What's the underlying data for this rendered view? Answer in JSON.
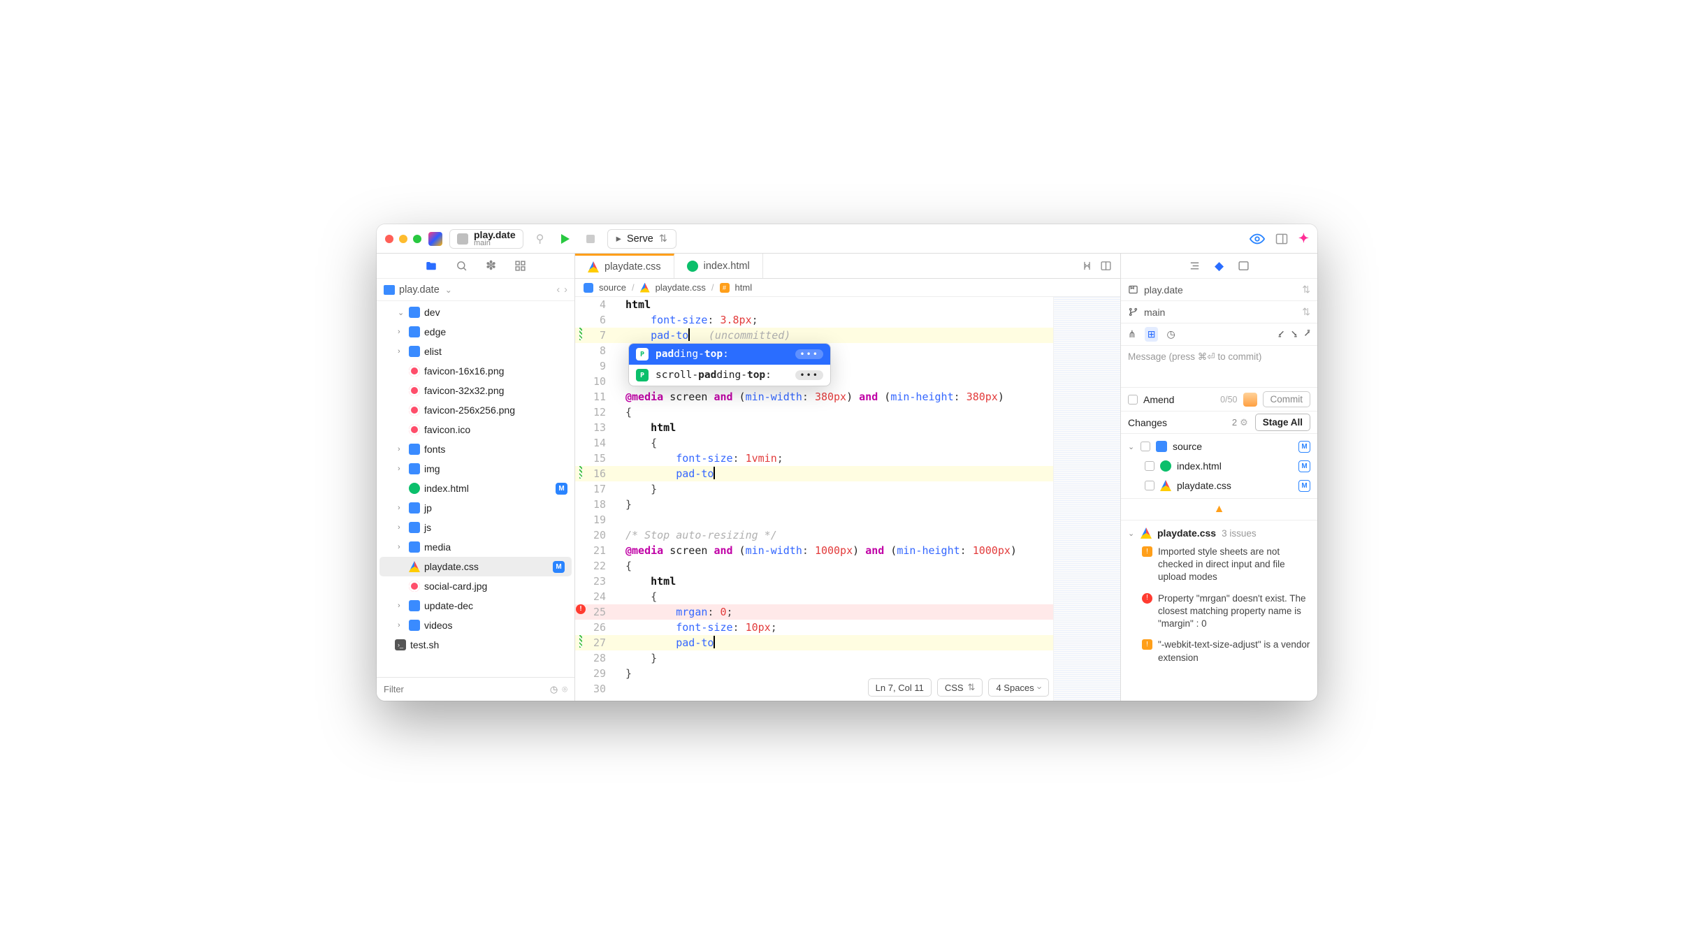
{
  "titlebar": {
    "project_name": "play.date",
    "branch": "main",
    "serve_label": "Serve"
  },
  "sidebar": {
    "crumb": "play.date",
    "filter_placeholder": "Filter",
    "items": [
      {
        "type": "folder",
        "name": "dev",
        "expanded": true,
        "depth": 1
      },
      {
        "type": "folder",
        "name": "edge",
        "depth": 1
      },
      {
        "type": "folder",
        "name": "elist",
        "depth": 1
      },
      {
        "type": "img",
        "name": "favicon-16x16.png",
        "depth": 1
      },
      {
        "type": "img",
        "name": "favicon-32x32.png",
        "depth": 1
      },
      {
        "type": "img",
        "name": "favicon-256x256.png",
        "depth": 1
      },
      {
        "type": "img",
        "name": "favicon.ico",
        "depth": 1
      },
      {
        "type": "folder",
        "name": "fonts",
        "depth": 1
      },
      {
        "type": "folder",
        "name": "img",
        "depth": 1
      },
      {
        "type": "html",
        "name": "index.html",
        "depth": 1,
        "modified": true
      },
      {
        "type": "folder",
        "name": "jp",
        "depth": 1
      },
      {
        "type": "folder",
        "name": "js",
        "depth": 1
      },
      {
        "type": "folder",
        "name": "media",
        "depth": 1
      },
      {
        "type": "css",
        "name": "playdate.css",
        "depth": 1,
        "modified": true,
        "selected": true
      },
      {
        "type": "img",
        "name": "social-card.jpg",
        "depth": 1
      },
      {
        "type": "folder",
        "name": "update-dec",
        "depth": 1
      },
      {
        "type": "folder",
        "name": "videos",
        "depth": 1
      },
      {
        "type": "sh",
        "name": "test.sh",
        "depth": 0
      }
    ]
  },
  "editor": {
    "tabs": [
      {
        "label": "playdate.css",
        "icon": "css",
        "active": true
      },
      {
        "label": "index.html",
        "icon": "html"
      }
    ],
    "breadcrumb": [
      {
        "icon": "folder",
        "label": "source"
      },
      {
        "icon": "css",
        "label": "playdate.css"
      },
      {
        "icon": "hash",
        "label": "html"
      }
    ],
    "first_line_number": 4,
    "lines": [
      {
        "n": 4,
        "tokens": [
          [
            "sel",
            "html"
          ]
        ]
      },
      {
        "n": 6,
        "tokens": [
          [
            "plain",
            "    "
          ],
          [
            "prop",
            "font-size"
          ],
          [
            "punc",
            ": "
          ],
          [
            "num",
            "3.8px"
          ],
          [
            "punc",
            ";"
          ]
        ]
      },
      {
        "n": 7,
        "hl": "yellow",
        "mark": "mod",
        "tokens": [
          [
            "plain",
            "    "
          ],
          [
            "prop",
            "pad-to"
          ],
          [
            "cursor",
            ""
          ],
          [
            "plain",
            "   "
          ],
          [
            "gray",
            "(uncommitted)"
          ]
        ]
      },
      {
        "n": 8,
        "tokens": []
      },
      {
        "n": 9,
        "tokens": []
      },
      {
        "n": 10,
        "tokens": []
      },
      {
        "n": 11,
        "tokens": [
          [
            "kw",
            "@media"
          ],
          [
            "plain",
            " screen "
          ],
          [
            "kw",
            "and"
          ],
          [
            "plain",
            " ("
          ],
          [
            "prop",
            "min-width"
          ],
          [
            "punc",
            ": "
          ],
          [
            "num",
            "380px"
          ],
          [
            "plain",
            ") "
          ],
          [
            "kw",
            "and"
          ],
          [
            "plain",
            " ("
          ],
          [
            "prop",
            "min-height"
          ],
          [
            "punc",
            ": "
          ],
          [
            "num",
            "380px"
          ],
          [
            "plain",
            ")"
          ]
        ]
      },
      {
        "n": 12,
        "tokens": [
          [
            "punc",
            "{"
          ]
        ]
      },
      {
        "n": 13,
        "tokens": [
          [
            "plain",
            "    "
          ],
          [
            "sel",
            "html"
          ]
        ]
      },
      {
        "n": 14,
        "tokens": [
          [
            "plain",
            "    "
          ],
          [
            "punc",
            "{"
          ]
        ]
      },
      {
        "n": 15,
        "tokens": [
          [
            "plain",
            "        "
          ],
          [
            "prop",
            "font-size"
          ],
          [
            "punc",
            ": "
          ],
          [
            "num",
            "1vmin"
          ],
          [
            "punc",
            ";"
          ]
        ]
      },
      {
        "n": 16,
        "hl": "yellow",
        "mark": "mod",
        "tokens": [
          [
            "plain",
            "        "
          ],
          [
            "prop",
            "pad-to"
          ],
          [
            "cursor",
            ""
          ]
        ]
      },
      {
        "n": 17,
        "tokens": [
          [
            "plain",
            "    "
          ],
          [
            "punc",
            "}"
          ]
        ]
      },
      {
        "n": 18,
        "tokens": [
          [
            "punc",
            "}"
          ]
        ]
      },
      {
        "n": 19,
        "tokens": []
      },
      {
        "n": 20,
        "tokens": [
          [
            "gray",
            "/* Stop auto-resizing */"
          ]
        ]
      },
      {
        "n": 21,
        "tokens": [
          [
            "kw",
            "@media"
          ],
          [
            "plain",
            " screen "
          ],
          [
            "kw",
            "and"
          ],
          [
            "plain",
            " ("
          ],
          [
            "prop",
            "min-width"
          ],
          [
            "punc",
            ": "
          ],
          [
            "num",
            "1000px"
          ],
          [
            "plain",
            ") "
          ],
          [
            "kw",
            "and"
          ],
          [
            "plain",
            " ("
          ],
          [
            "prop",
            "min-height"
          ],
          [
            "punc",
            ": "
          ],
          [
            "num",
            "1000px"
          ],
          [
            "plain",
            ")"
          ]
        ]
      },
      {
        "n": 22,
        "tokens": [
          [
            "punc",
            "{"
          ]
        ]
      },
      {
        "n": 23,
        "tokens": [
          [
            "plain",
            "    "
          ],
          [
            "sel",
            "html"
          ]
        ]
      },
      {
        "n": 24,
        "tokens": [
          [
            "plain",
            "    "
          ],
          [
            "punc",
            "{"
          ]
        ]
      },
      {
        "n": 25,
        "hl": "red",
        "mark": "err",
        "tokens": [
          [
            "plain",
            "        "
          ],
          [
            "prop",
            "mrgan"
          ],
          [
            "punc",
            ": "
          ],
          [
            "num",
            "0"
          ],
          [
            "punc",
            ";"
          ]
        ]
      },
      {
        "n": 26,
        "tokens": [
          [
            "plain",
            "        "
          ],
          [
            "prop",
            "font-size"
          ],
          [
            "punc",
            ": "
          ],
          [
            "num",
            "10px"
          ],
          [
            "punc",
            ";"
          ]
        ]
      },
      {
        "n": 27,
        "hl": "yellow",
        "mark": "mod",
        "tokens": [
          [
            "plain",
            "        "
          ],
          [
            "prop",
            "pad-to"
          ],
          [
            "cursor",
            ""
          ]
        ]
      },
      {
        "n": 28,
        "tokens": [
          [
            "plain",
            "    "
          ],
          [
            "punc",
            "}"
          ]
        ]
      },
      {
        "n": 29,
        "tokens": [
          [
            "punc",
            "}"
          ]
        ]
      },
      {
        "n": 30,
        "tokens": []
      }
    ],
    "autocomplete": {
      "items": [
        {
          "badge": "P",
          "prefix_bold": "pad",
          "middle": "ding-",
          "suffix_bold": "top",
          "trail": ":",
          "selected": true
        },
        {
          "badge": "P",
          "prefix": "scroll-",
          "mid_bold": "pad",
          "middle2": "ding-",
          "suffix_bold": "top",
          "trail": ":"
        }
      ]
    },
    "status": {
      "position": "Ln 7, Col 11",
      "lang": "CSS",
      "indent": "4 Spaces"
    }
  },
  "rpanel": {
    "project": "play.date",
    "branch": "main",
    "commit_placeholder": "Message (press ⌘⏎ to commit)",
    "amend_label": "Amend",
    "commit_counter": "0/50",
    "commit_btn": "Commit",
    "changes_label": "Changes",
    "changes_count": "2",
    "stage_all": "Stage All",
    "changes": [
      {
        "type": "folder",
        "name": "source",
        "depth": 0,
        "expanded": true,
        "badge": "M"
      },
      {
        "type": "html",
        "name": "index.html",
        "depth": 1,
        "badge": "M"
      },
      {
        "type": "css",
        "name": "playdate.css",
        "depth": 1,
        "badge": "M"
      }
    ],
    "issues_file": "playdate.css",
    "issues_count_label": "3 issues",
    "issues": [
      {
        "level": "warn",
        "text": "Imported style sheets are not checked in direct input and file upload modes"
      },
      {
        "level": "err",
        "text": "Property \"mrgan\" doesn't exist. The closest matching property name is \"margin\" : 0"
      },
      {
        "level": "warn",
        "text": "\"-webkit-text-size-adjust\" is a vendor extension"
      }
    ]
  }
}
